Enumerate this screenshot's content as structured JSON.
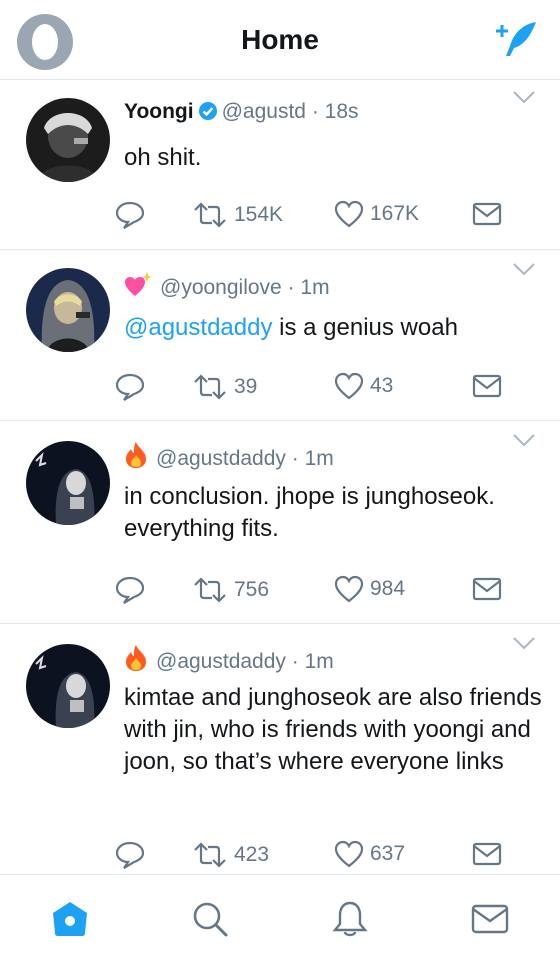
{
  "header": {
    "title": "Home"
  },
  "tweets": [
    {
      "name": "Yoongi",
      "verified": true,
      "handle": "@agustd",
      "time": "· 18s",
      "emoji": "",
      "mention": "",
      "text": "oh shit.",
      "retweets": "154K",
      "likes": "167K"
    },
    {
      "name": "",
      "verified": false,
      "handle": "@yoongilove",
      "time": "· 1m",
      "emoji": "heart-sparkle",
      "mention": "@agustdaddy",
      "text": " is a genius woah",
      "retweets": "39",
      "likes": "43"
    },
    {
      "name": "",
      "verified": false,
      "handle": "@agustdaddy",
      "time": "· 1m",
      "emoji": "fire",
      "mention": "",
      "text": "in conclusion. jhope is junghoseok. everything fits.",
      "retweets": "756",
      "likes": "984"
    },
    {
      "name": "",
      "verified": false,
      "handle": "@agustdaddy",
      "time": "· 1m",
      "emoji": "fire",
      "mention": "",
      "text": "kimtae and junghoseok are also friends with jin, who is friends with yoongi and joon, so that’s where everyone links",
      "retweets": "423",
      "likes": "637"
    }
  ],
  "tabs": [
    "home-icon",
    "search-icon",
    "bell-icon",
    "mail-icon"
  ],
  "colors": {
    "accent": "#1da1f2",
    "muted": "#657786",
    "divider": "#e1e8ed",
    "text": "#14171a",
    "fire": "#ff5a1f",
    "heart": "#ff4fa3"
  }
}
